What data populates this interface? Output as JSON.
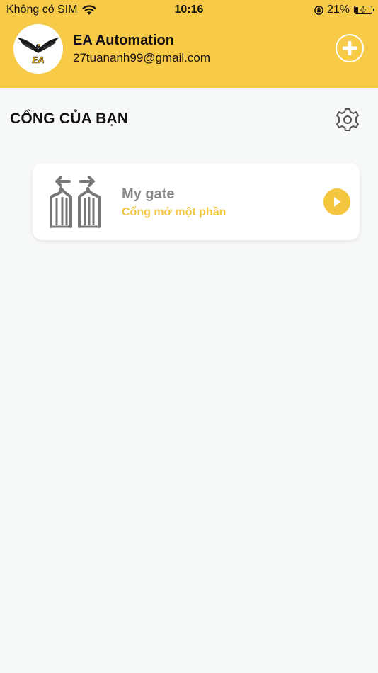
{
  "status_bar": {
    "carrier": "Không có SIM",
    "time": "10:16",
    "battery": "21%",
    "battery_level": 0.21
  },
  "header": {
    "user_name": "EA Automation",
    "email": "27tuananh99@gmail.com",
    "logo_text": "EA",
    "add_icon": "plus-circle-icon"
  },
  "section": {
    "title": "CỔNG CỦA BẠN",
    "settings_icon": "gear-icon"
  },
  "gates": [
    {
      "name": "My gate",
      "status": "Cổng mở một phần",
      "icon": "sliding-gate-icon",
      "action_icon": "play-icon"
    }
  ],
  "colors": {
    "header_bg": "#f7ca47",
    "accent": "#f4c53f",
    "background": "#f7f8f8",
    "card_bg": "#ffffff",
    "gate_name": "#8a8a8a"
  }
}
